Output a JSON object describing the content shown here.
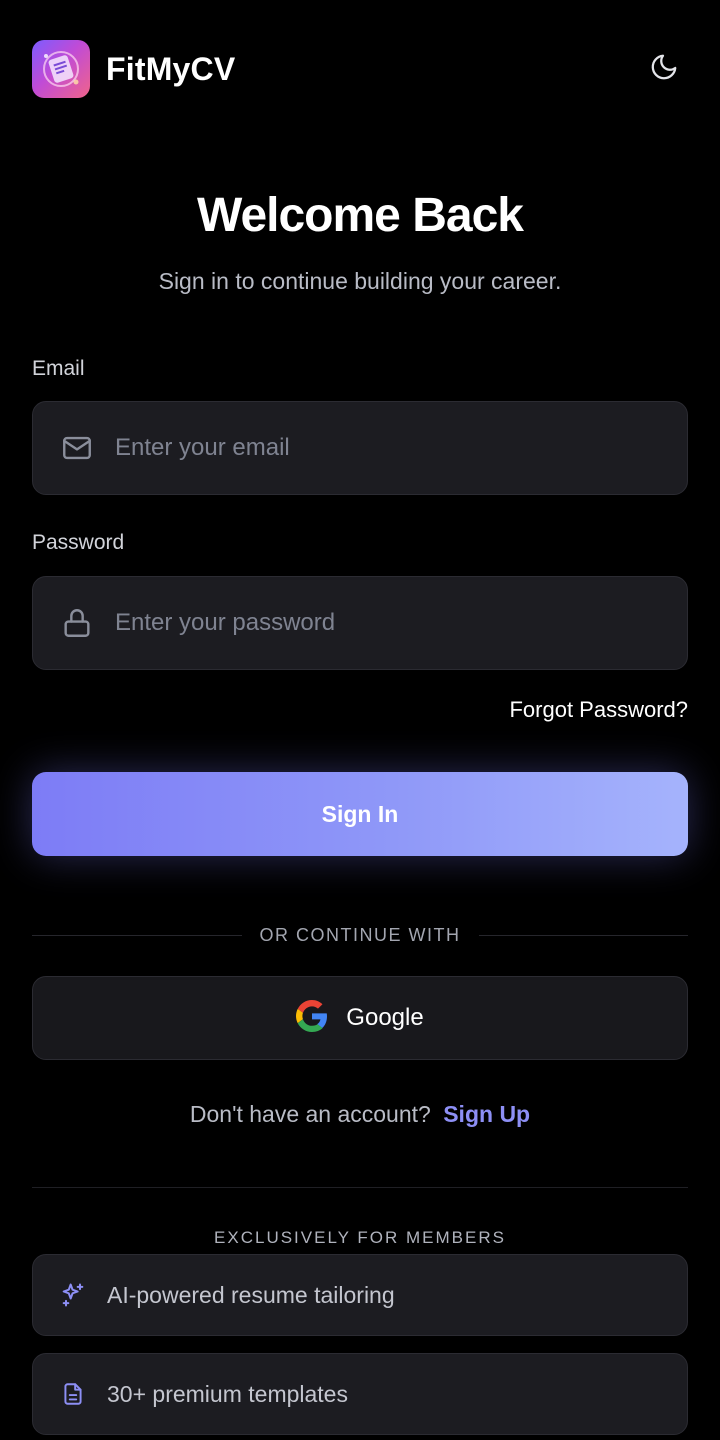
{
  "header": {
    "brand_name": "FitMyCV",
    "logo_icon": "fitmycv-logo",
    "theme_toggle_icon": "moon-icon"
  },
  "hero": {
    "title": "Welcome Back",
    "subtitle": "Sign in to continue building your career."
  },
  "form": {
    "email": {
      "label": "Email",
      "placeholder": "Enter your email",
      "icon": "mail-icon",
      "value": ""
    },
    "password": {
      "label": "Password",
      "placeholder": "Enter your password",
      "icon": "lock-icon",
      "value": ""
    },
    "forgot_password": "Forgot Password?",
    "submit_label": "Sign In"
  },
  "social": {
    "divider_text": "OR CONTINUE WITH",
    "google_label": "Google",
    "google_icon": "google-icon"
  },
  "signup": {
    "prompt": "Don't have an account?",
    "link": "Sign Up"
  },
  "members": {
    "heading": "EXCLUSIVELY FOR MEMBERS",
    "features": [
      {
        "label": "AI-powered resume tailoring",
        "icon": "sparkles-icon"
      },
      {
        "label": "30+ premium templates",
        "icon": "document-icon"
      }
    ]
  },
  "colors": {
    "background": "#000000",
    "accent": "#8d8ff5",
    "button_gradient_start": "#7d7cf6",
    "button_gradient_end": "#a5b3fc",
    "field_background": "#1c1c21"
  }
}
